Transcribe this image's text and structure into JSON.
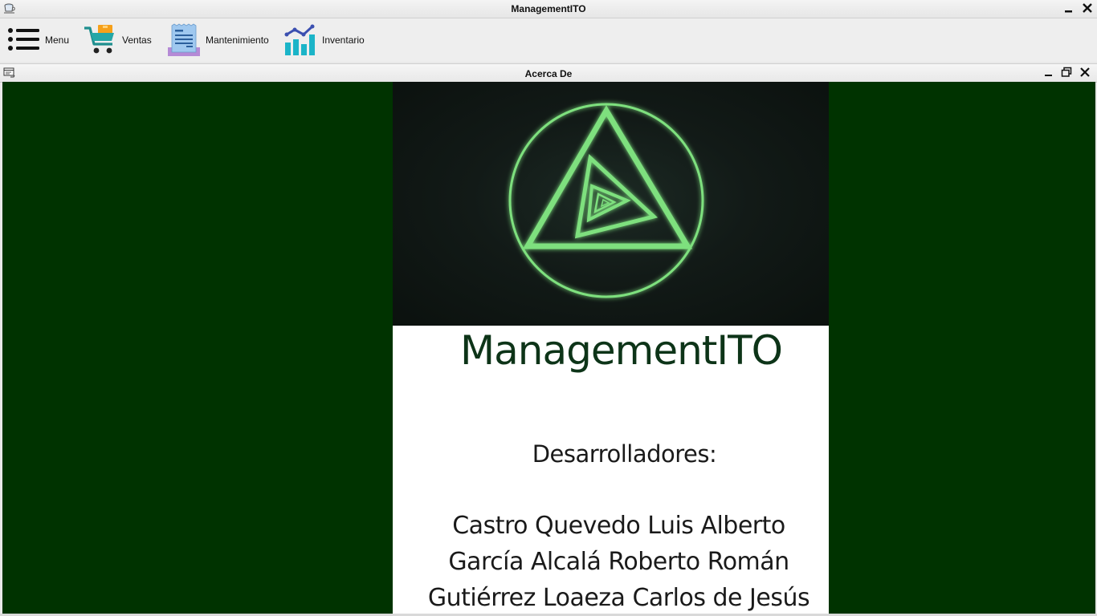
{
  "window": {
    "title": "ManagementITO",
    "icon": "app-cup-icon",
    "controls": [
      "minimize-icon",
      "close-icon"
    ]
  },
  "toolbar": {
    "items": [
      {
        "label": "Menu",
        "icon": "menu-list-icon"
      },
      {
        "label": "Ventas",
        "icon": "shopping-cart-icon"
      },
      {
        "label": "Mantenimiento",
        "icon": "document-receipt-icon"
      },
      {
        "label": "Inventario",
        "icon": "bar-chart-icon"
      }
    ]
  },
  "internal_frame": {
    "title": "Acerca De",
    "icon": "frame-icon",
    "controls": [
      "minimize-icon",
      "maximize-icon",
      "close-icon"
    ],
    "background": "#003300"
  },
  "about": {
    "brand": "ManagementITO",
    "developers_heading": "Desarrolladores:",
    "developers": [
      "Castro Quevedo Luis Alberto",
      "García Alcalá Roberto Román",
      "Gutiérrez Loaeza Carlos de Jesús"
    ],
    "logo_color": "#7ee07e"
  }
}
